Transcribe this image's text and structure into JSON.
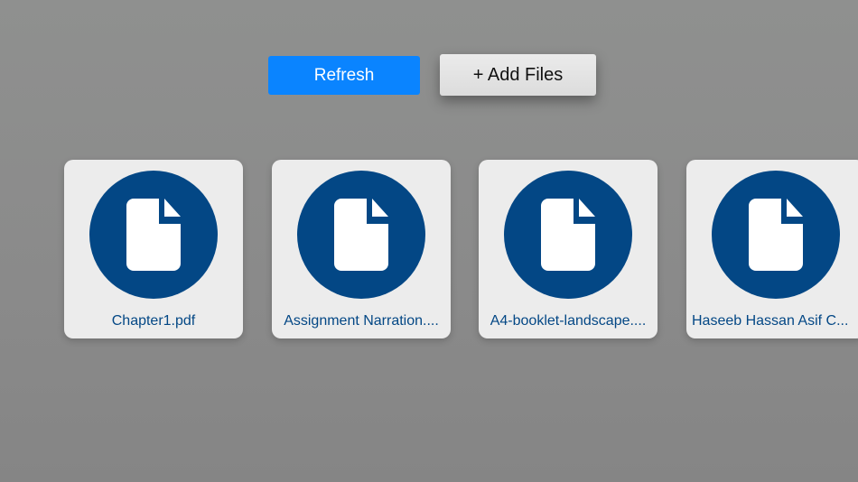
{
  "toolbar": {
    "refresh_label": "Refresh",
    "add_files_label": "+ Add Files"
  },
  "files": [
    {
      "name": "Chapter1.pdf",
      "icon": "document-icon"
    },
    {
      "name": "Assignment Narration....",
      "icon": "document-icon"
    },
    {
      "name": "A4-booklet-landscape....",
      "icon": "document-icon"
    },
    {
      "name": "Haseeb Hassan Asif C...",
      "icon": "document-icon"
    }
  ],
  "colors": {
    "accent": "#0a84ff",
    "icon_circle": "#034785",
    "card_bg": "#ececec",
    "background": "#8a8a8a"
  }
}
